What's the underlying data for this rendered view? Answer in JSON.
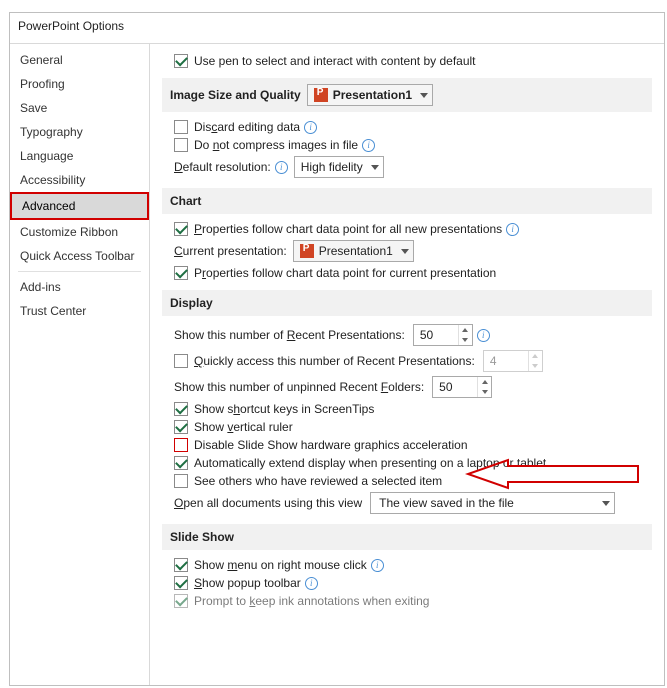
{
  "window": {
    "title": "PowerPoint Options"
  },
  "sidebar": {
    "items": [
      "General",
      "Proofing",
      "Save",
      "Typography",
      "Language",
      "Accessibility",
      "Advanced",
      "Customize Ribbon",
      "Quick Access Toolbar",
      "Add-ins",
      "Trust Center"
    ],
    "selected_index": 6
  },
  "top_option": {
    "label": "Use pen to select and interact with content by default"
  },
  "image_size_quality": {
    "header": "Image Size and Quality",
    "dropdown": "Presentation1",
    "discard": "Discard editing data",
    "no_compress": "Do not compress images in file",
    "default_res_label": "Default resolution:",
    "default_res_value": "High fidelity"
  },
  "chart": {
    "header": "Chart",
    "prop_all": "Properties follow chart data point for all new presentations",
    "current_label": "Current presentation:",
    "current_value": "Presentation1",
    "prop_current": "Properties follow chart data point for current presentation"
  },
  "display": {
    "header": "Display",
    "recent_pres_label": "Show this number of Recent Presentations:",
    "recent_pres_value": "50",
    "quick_access": "Quickly access this number of Recent Presentations:",
    "quick_access_value": "4",
    "recent_folders_label": "Show this number of unpinned Recent Folders:",
    "recent_folders_value": "50",
    "shortcut_keys": "Show shortcut keys in ScreenTips",
    "vertical_ruler": "Show vertical ruler",
    "disable_hw": "Disable Slide Show hardware graphics acceleration",
    "auto_extend": "Automatically extend display when presenting on a laptop or tablet",
    "see_others": "See others who have reviewed a selected item",
    "open_all_label": "Open all documents using this view",
    "open_all_value": "The view saved in the file"
  },
  "slide_show": {
    "header": "Slide Show",
    "right_click": "Show menu on right mouse click",
    "popup": "Show popup toolbar",
    "ink": "Prompt to keep ink annotations when exiting"
  }
}
